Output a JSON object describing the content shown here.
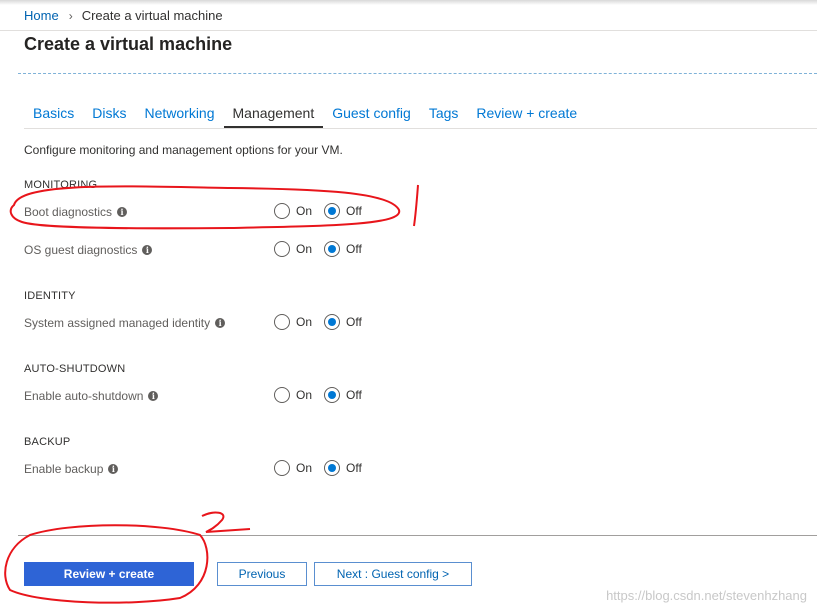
{
  "breadcrumb": {
    "home": "Home",
    "current": "Create a virtual machine"
  },
  "page_title": "Create a virtual machine",
  "tabs": [
    {
      "label": "Basics",
      "active": false
    },
    {
      "label": "Disks",
      "active": false
    },
    {
      "label": "Networking",
      "active": false
    },
    {
      "label": "Management",
      "active": true
    },
    {
      "label": "Guest config",
      "active": false
    },
    {
      "label": "Tags",
      "active": false
    },
    {
      "label": "Review + create",
      "active": false
    }
  ],
  "intro": "Configure monitoring and management options for your VM.",
  "sections": {
    "monitoring": {
      "title": "MONITORING",
      "boot_diagnostics": {
        "label": "Boot diagnostics",
        "value": "Off"
      },
      "os_guest_diagnostics": {
        "label": "OS guest diagnostics",
        "value": "Off"
      }
    },
    "identity": {
      "title": "IDENTITY",
      "system_identity": {
        "label": "System assigned managed identity",
        "value": "Off"
      }
    },
    "auto_shutdown": {
      "title": "AUTO-SHUTDOWN",
      "enable_auto_shutdown": {
        "label": "Enable auto-shutdown",
        "value": "Off"
      }
    },
    "backup": {
      "title": "BACKUP",
      "enable_backup": {
        "label": "Enable backup",
        "value": "Off"
      }
    }
  },
  "radio_labels": {
    "on": "On",
    "off": "Off"
  },
  "info_glyph": "i",
  "footer": {
    "review_create": "Review + create",
    "previous": "Previous",
    "next": "Next : Guest config >"
  },
  "annotations": {
    "mark_1": "1",
    "mark_2": "2"
  },
  "watermark": "https://blog.csdn.net/stevenhzhang",
  "colors": {
    "accent": "#0078d4",
    "primary_button": "#2e64d6",
    "annotation": "#e8151b"
  }
}
